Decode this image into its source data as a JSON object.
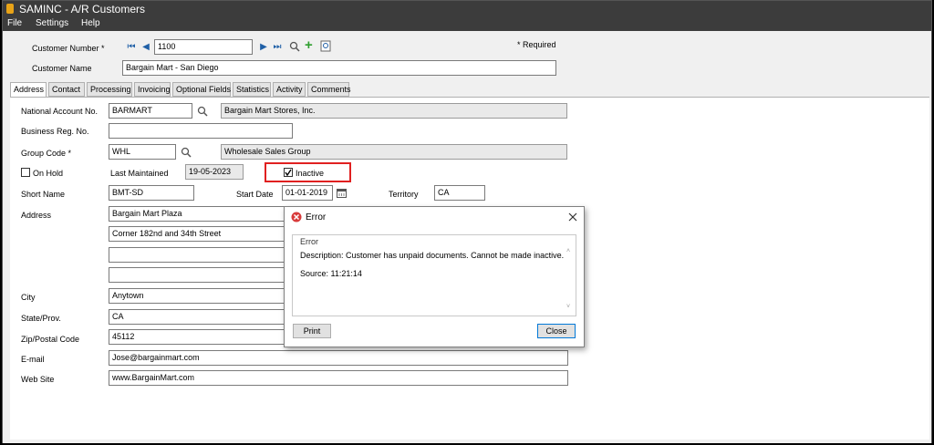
{
  "window": {
    "title": "SAMINC - A/R Customers"
  },
  "menu": {
    "file": "File",
    "settings": "Settings",
    "help": "Help"
  },
  "header": {
    "customer_number_label": "Customer Number *",
    "customer_number": "1100",
    "customer_name_label": "Customer Name",
    "customer_name": "Bargain Mart - San Diego",
    "required_note": "* Required"
  },
  "tabs": [
    "Address",
    "Contact",
    "Processing",
    "Invoicing",
    "Optional Fields",
    "Statistics",
    "Activity",
    "Comments"
  ],
  "form": {
    "national_account_label": "National Account No.",
    "national_account": "BARMART",
    "national_account_desc": "Bargain Mart Stores, Inc.",
    "business_reg_label": "Business Reg. No.",
    "business_reg": "",
    "group_code_label": "Group Code *",
    "group_code": "WHL",
    "group_code_desc": "Wholesale Sales Group",
    "on_hold_label": "On Hold",
    "last_maintained_label": "Last Maintained",
    "last_maintained": "19-05-2023",
    "inactive_label": "Inactive",
    "inactive_checked": true,
    "short_name_label": "Short Name",
    "short_name": "BMT-SD",
    "start_date_label": "Start Date",
    "start_date": "01-01-2019",
    "territory_label": "Territory",
    "territory": "CA",
    "address_label": "Address",
    "address_line1": "Bargain Mart Plaza",
    "address_line2": "Corner 182nd and 34th Street",
    "address_line3": "",
    "address_line4": "",
    "city_label": "City",
    "city": "Anytown",
    "state_label": "State/Prov.",
    "state": "CA",
    "zip_label": "Zip/Postal Code",
    "zip": "45112",
    "email_label": "E-mail",
    "email": "Jose@bargainmart.com",
    "website_label": "Web Site",
    "website": "www.BargainMart.com"
  },
  "dialog": {
    "title": "Error",
    "group_label": "Error",
    "description": "Description: Customer has unpaid documents. Cannot be made inactive.",
    "source": "Source:  11:21:14",
    "print_label": "Print",
    "close_label": "Close"
  },
  "colors": {
    "titlebar": "#3c3c3c",
    "error_red": "#d83b3b",
    "highlight": "#e02020",
    "nav_blue": "#1f5fa6",
    "add_green": "#2e9e2e"
  }
}
